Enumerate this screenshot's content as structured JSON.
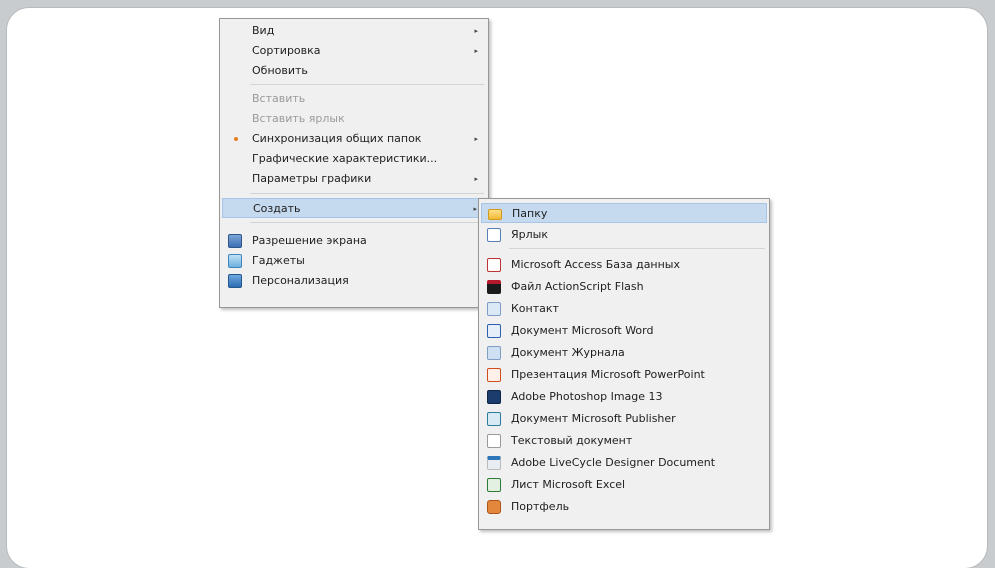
{
  "main_menu": {
    "items": [
      {
        "label": "Вид",
        "submenu": true,
        "enabled": true
      },
      {
        "label": "Сортировка",
        "submenu": true,
        "enabled": true
      },
      {
        "label": "Обновить",
        "submenu": false,
        "enabled": true
      },
      {
        "label": "Вставить",
        "submenu": false,
        "enabled": false
      },
      {
        "label": "Вставить ярлык",
        "submenu": false,
        "enabled": false
      },
      {
        "label": "Синхронизация общих папок",
        "submenu": true,
        "enabled": true,
        "icon": "sync-dot-icon"
      },
      {
        "label": "Графические характеристики...",
        "submenu": false,
        "enabled": true
      },
      {
        "label": "Параметры графики",
        "submenu": true,
        "enabled": true
      },
      {
        "label": "Создать",
        "submenu": true,
        "enabled": true,
        "highlighted": true
      },
      {
        "label": "Разрешение экрана",
        "submenu": false,
        "enabled": true,
        "icon": "screen-resolution-icon"
      },
      {
        "label": "Гаджеты",
        "submenu": false,
        "enabled": true,
        "icon": "gadgets-icon"
      },
      {
        "label": "Персонализация",
        "submenu": false,
        "enabled": true,
        "icon": "personalization-icon"
      }
    ]
  },
  "submenu_create": {
    "items": [
      {
        "label": "Папку",
        "icon": "folder-icon",
        "highlighted": true
      },
      {
        "label": "Ярлык",
        "icon": "shortcut-icon"
      },
      {
        "label": "Microsoft Access База данных",
        "icon": "access-icon"
      },
      {
        "label": "Файл ActionScript Flash",
        "icon": "flash-icon"
      },
      {
        "label": "Контакт",
        "icon": "contact-icon"
      },
      {
        "label": "Документ Microsoft Word",
        "icon": "word-icon"
      },
      {
        "label": "Документ Журнала",
        "icon": "journal-icon"
      },
      {
        "label": "Презентация Microsoft PowerPoint",
        "icon": "powerpoint-icon"
      },
      {
        "label": "Adobe Photoshop Image 13",
        "icon": "photoshop-icon"
      },
      {
        "label": "Документ Microsoft Publisher",
        "icon": "publisher-icon"
      },
      {
        "label": "Текстовый документ",
        "icon": "text-document-icon"
      },
      {
        "label": "Adobe LiveCycle Designer Document",
        "icon": "livecycle-icon"
      },
      {
        "label": "Лист Microsoft Excel",
        "icon": "excel-icon"
      },
      {
        "label": "Портфель",
        "icon": "briefcase-icon"
      }
    ]
  },
  "submenu_arrow_glyph": "▸",
  "colors": {
    "highlight": "#c5d9ef",
    "menu_bg": "#f0f0f0",
    "disabled_text": "#9a9a9a"
  }
}
